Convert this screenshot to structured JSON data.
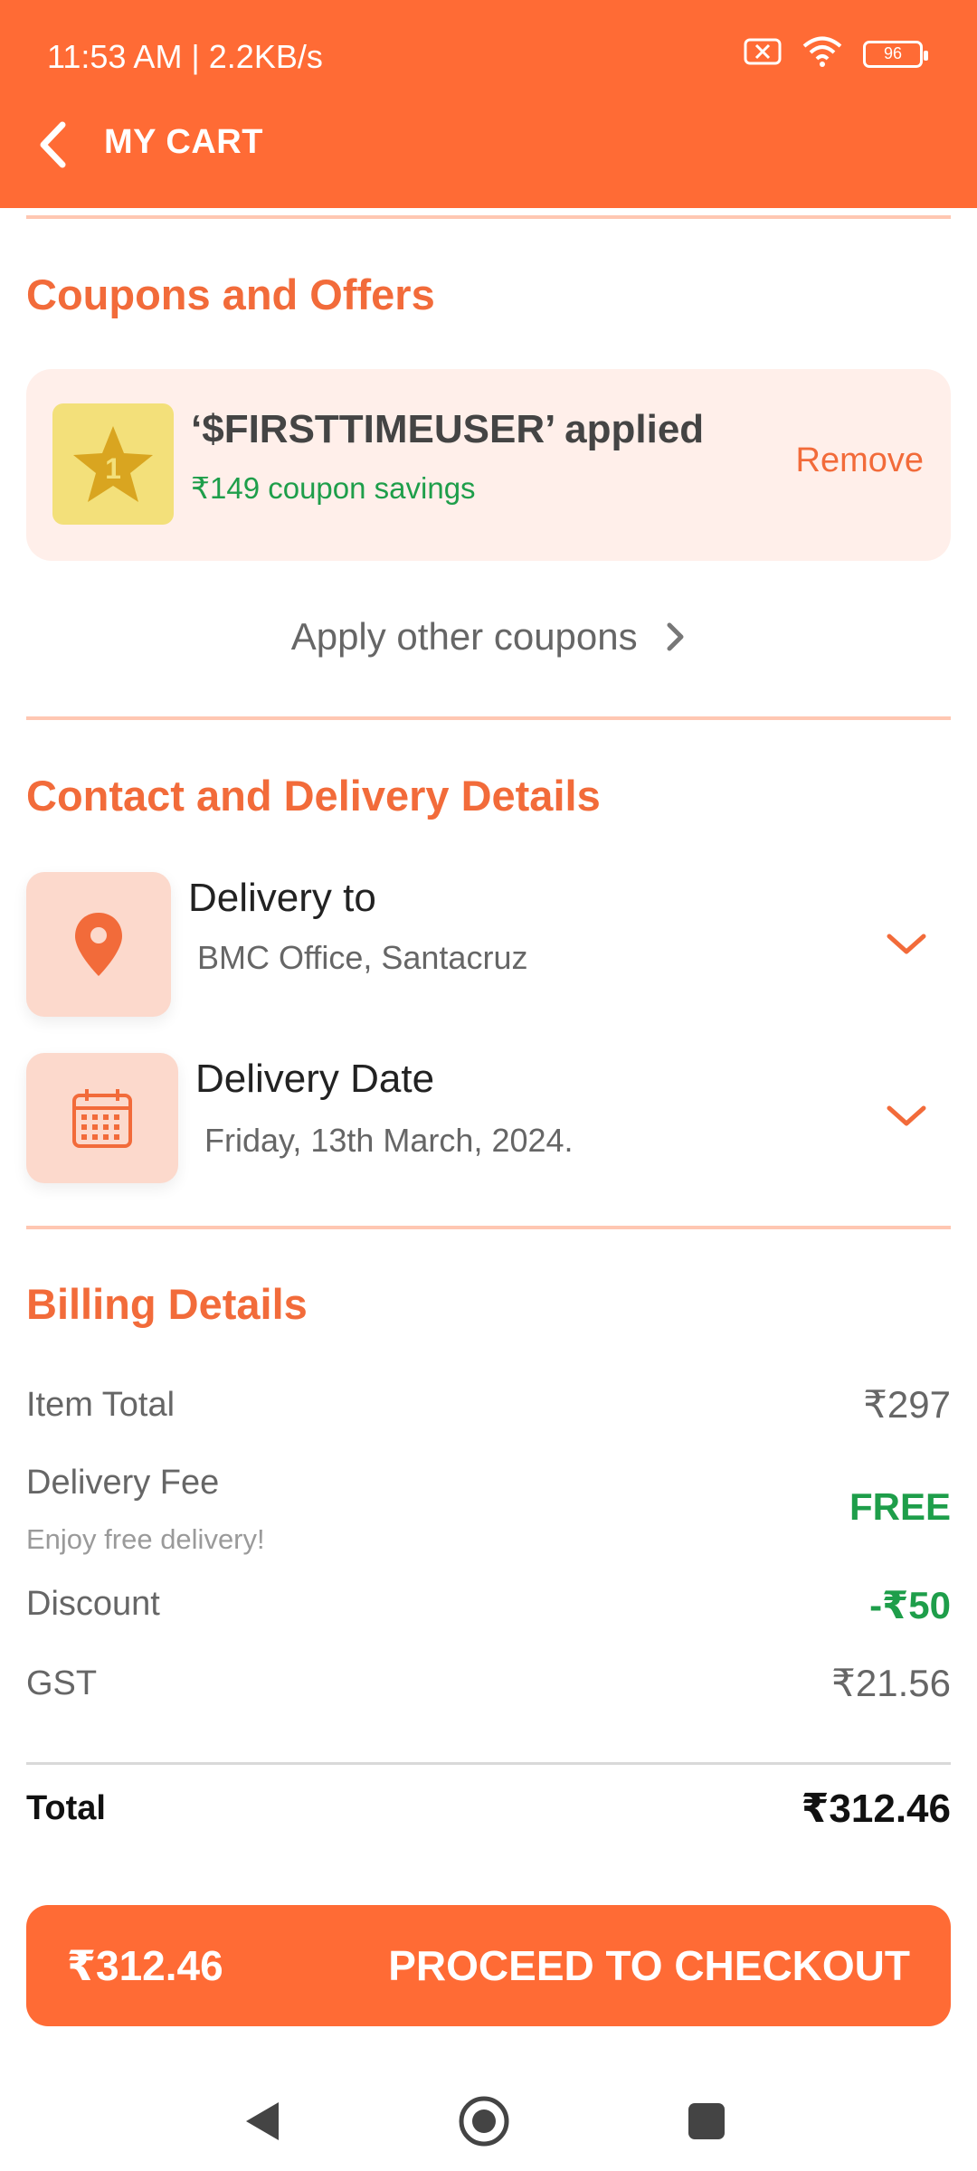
{
  "status_bar": {
    "time_speed": "11:53 AM | 2.2KB/s",
    "battery": "96"
  },
  "header": {
    "title": "MY CART"
  },
  "coupons": {
    "section_title": "Coupons and Offers",
    "badge_number": "1",
    "applied_text": "‘$FIRSTTIMEUSER’ applied",
    "savings_text": "₹149 coupon savings",
    "remove_label": "Remove",
    "apply_other_label": "Apply other coupons"
  },
  "delivery": {
    "section_title": "Contact and Delivery Details",
    "location_title": "Delivery to",
    "location_value": "BMC Office, Santacruz",
    "date_title": "Delivery Date",
    "date_value": "Friday, 13th March, 2024."
  },
  "billing": {
    "section_title": "Billing Details",
    "item_total_label": "Item Total",
    "item_total_value": "₹297",
    "delivery_fee_label": "Delivery Fee",
    "delivery_fee_value": "FREE",
    "delivery_note": "Enjoy free delivery!",
    "discount_label": "Discount",
    "discount_value": "-₹50",
    "gst_label": "GST",
    "gst_value": "₹21.56",
    "total_label": "Total",
    "total_value": "₹312.46"
  },
  "checkout": {
    "price": "₹312.46",
    "label": "PROCEED TO CHECKOUT"
  },
  "colors": {
    "accent": "#FF6B35",
    "green": "#1E9E4A",
    "soft": "#FFEFEA"
  },
  "icons": [
    "back-arrow-icon",
    "sim-off-icon",
    "wifi-icon",
    "battery-icon",
    "star-badge-icon",
    "chevron-right-icon",
    "location-pin-icon",
    "calendar-icon",
    "chevron-down-icon",
    "nav-back-icon",
    "nav-home-icon",
    "nav-recents-icon"
  ]
}
